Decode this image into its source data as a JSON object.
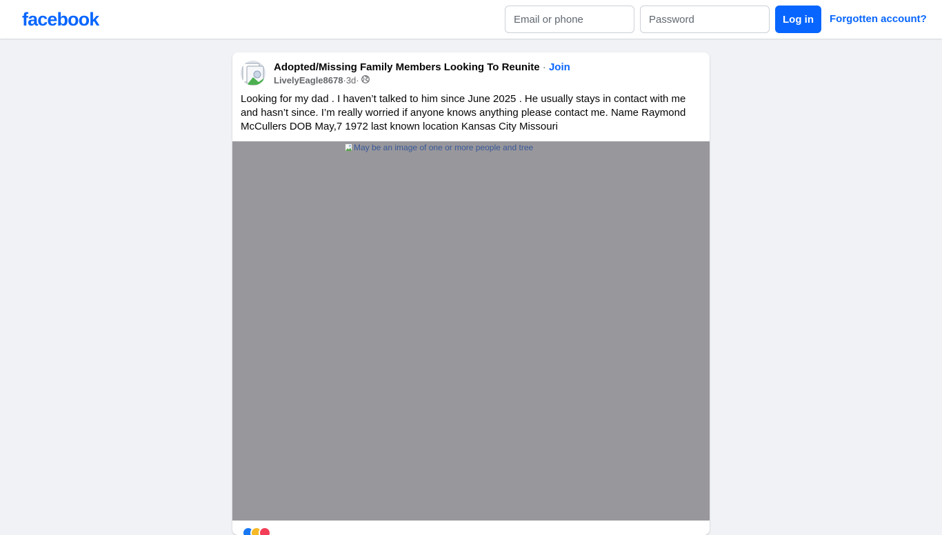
{
  "brand": {
    "logo_text": "facebook",
    "accent_color": "#0866ff"
  },
  "login": {
    "email_placeholder": "Email or phone",
    "password_placeholder": "Password",
    "login_label": "Log in",
    "forgot_label": "Forgotten account?"
  },
  "post": {
    "group_name": "Adopted/Missing Family Members Looking To Reunite",
    "separator": " · ",
    "join_label": "Join",
    "author": "LivelyEagle8678",
    "age": "3d",
    "privacy_icon": "globe-icon",
    "text": "Looking for my dad . I haven’t talked to him since June 2025 . He usually stays in contact with me and hasn’t since. I’m really worried if anyone knows anything please contact me. Name Raymond McCullers DOB May,7 1972 last known location Kansas City Missouri",
    "image_alt": "May be an image of one or more people and tree",
    "reactions": [
      {
        "icon": "like-reaction-icon",
        "color": "#1877f2"
      },
      {
        "icon": "care-reaction-icon",
        "color": "#f7b928"
      },
      {
        "icon": "love-reaction-icon",
        "color": "#f33e58"
      }
    ]
  }
}
